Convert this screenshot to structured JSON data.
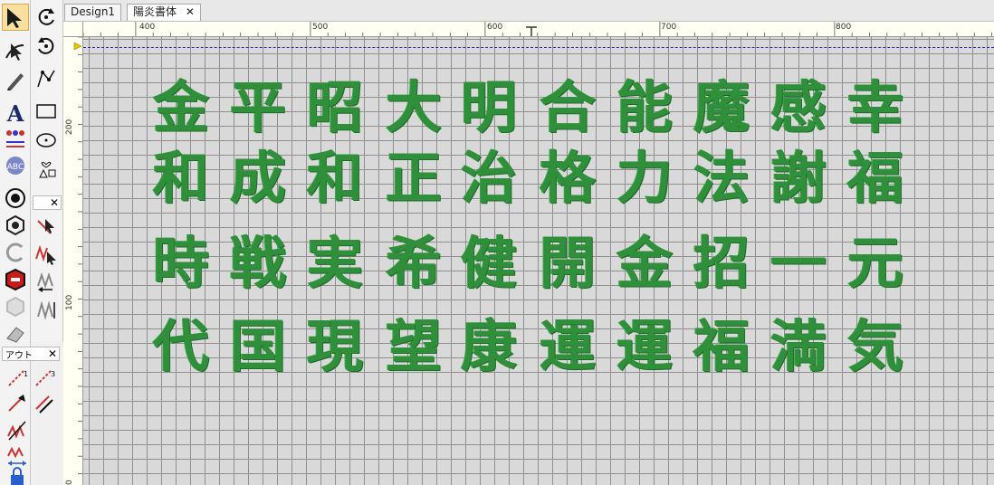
{
  "tabs": [
    {
      "label": "Design1",
      "active": false
    },
    {
      "label": "陽炎書体",
      "active": true
    }
  ],
  "panel": {
    "title": "アウト"
  },
  "ruler": {
    "horizontal": [
      "400",
      "500",
      "600",
      "700",
      "800"
    ],
    "vertical": [
      "200",
      "100",
      "0"
    ]
  },
  "canvas": {
    "embroidery_color": "#2f8f3a",
    "rows": [
      [
        "金",
        "平",
        "昭",
        "大",
        "明",
        "合",
        "能",
        "魔",
        "感",
        "幸"
      ],
      [
        "和",
        "成",
        "和",
        "正",
        "治",
        "格",
        "力",
        "法",
        "謝",
        "福"
      ],
      [
        "時",
        "戦",
        "実",
        "希",
        "健",
        "開",
        "金",
        "招",
        "一",
        "元"
      ],
      [
        "代",
        "国",
        "現",
        "望",
        "康",
        "運",
        "運",
        "福",
        "満",
        "気"
      ]
    ]
  },
  "toolbar": {
    "col1": [
      "select-arrow-icon",
      "reshape-icon",
      "pen-icon",
      "text-icon",
      "people-icon",
      "monogram-icon",
      "circle-target-icon",
      "hexagon-icon",
      "outline-icon",
      "stop-hex-icon",
      "hexagon-light-icon",
      "eraser-icon"
    ],
    "col2": [
      "rotate-cw-icon",
      "rotate-ccw-icon",
      "node-edit-icon",
      "rectangle-icon",
      "ellipse-icon",
      "shapes-icon",
      "cursor-stitch-icon",
      "zigzag-cursor-icon",
      "zigzag-arrow-icon",
      "zigzag-gray-icon"
    ],
    "panel_tools": [
      "outline-1-icon",
      "outline-3-icon",
      "outline-arrow-icon",
      "outline-double-icon",
      "outline-zigzag-icon",
      "stitch-width-icon",
      "lock-icon"
    ]
  }
}
